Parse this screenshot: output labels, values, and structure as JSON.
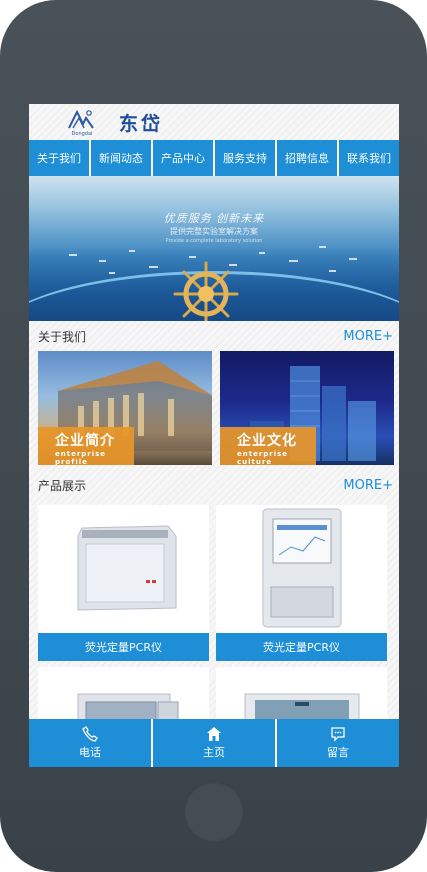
{
  "brand": {
    "name": "东岱",
    "logo_sub": "Dongdai"
  },
  "nav": [
    {
      "label": "关于我们"
    },
    {
      "label": "新闻动态"
    },
    {
      "label": "产品中心"
    },
    {
      "label": "服务支持"
    },
    {
      "label": "招聘信息"
    },
    {
      "label": "联系我们"
    }
  ],
  "banner": {
    "title": "优质服务 创新未来",
    "subtitle": "提供完整实验室解决方案",
    "subtitle_en": "Provide a complete laboratory solution",
    "icon": "ship-wheel-icon"
  },
  "about": {
    "title": "关于我们",
    "more": "MORE+",
    "cards": [
      {
        "zh": "企业简介",
        "en": "enterprise profile"
      },
      {
        "zh": "企业文化",
        "en": "enterprise culture"
      }
    ]
  },
  "products": {
    "title": "产品展示",
    "more": "MORE+",
    "items": [
      {
        "name": "荧光定量PCR仪"
      },
      {
        "name": "荧光定量PCR仪"
      },
      {
        "name": ""
      },
      {
        "name": ""
      }
    ]
  },
  "footer": [
    {
      "label": "电话",
      "icon": "phone-icon"
    },
    {
      "label": "主页",
      "icon": "home-icon"
    },
    {
      "label": "留言",
      "icon": "message-icon"
    }
  ],
  "colors": {
    "accent": "#1e8fd6",
    "brand": "#1f4d9a",
    "label_orange": "#e89628"
  }
}
